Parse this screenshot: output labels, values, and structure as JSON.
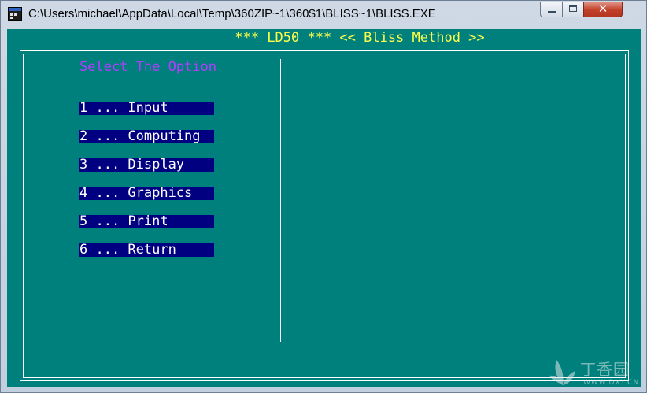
{
  "window": {
    "title": "C:\\Users\\michael\\AppData\\Local\\Temp\\360ZIP~1\\360$1\\BLISS~1\\BLISS.EXE",
    "icon": "console-app-icon",
    "controls": {
      "minimize_icon": "minimize-icon",
      "maximize_icon": "maximize-icon",
      "close_icon": "close-icon",
      "close_glyph": "✕"
    }
  },
  "console": {
    "header": "*** LD50 *** << Bliss Method >>",
    "prompt": "Select The Option",
    "menu": [
      {
        "label": "1 ... Input"
      },
      {
        "label": "2 ... Computing"
      },
      {
        "label": "3 ... Display"
      },
      {
        "label": "4 ... Graphics"
      },
      {
        "label": "5 ... Print"
      },
      {
        "label": "6 ... Return"
      }
    ]
  },
  "watermark": {
    "text": "丁香园",
    "sub": "WWW.DXY.CN"
  },
  "colors": {
    "console_bg": "#00807d",
    "header_fg": "#ffff4a",
    "prompt_fg": "#b43cff",
    "menu_bg": "#000080",
    "menu_fg": "#ffffff",
    "frame": "#ffffff"
  }
}
